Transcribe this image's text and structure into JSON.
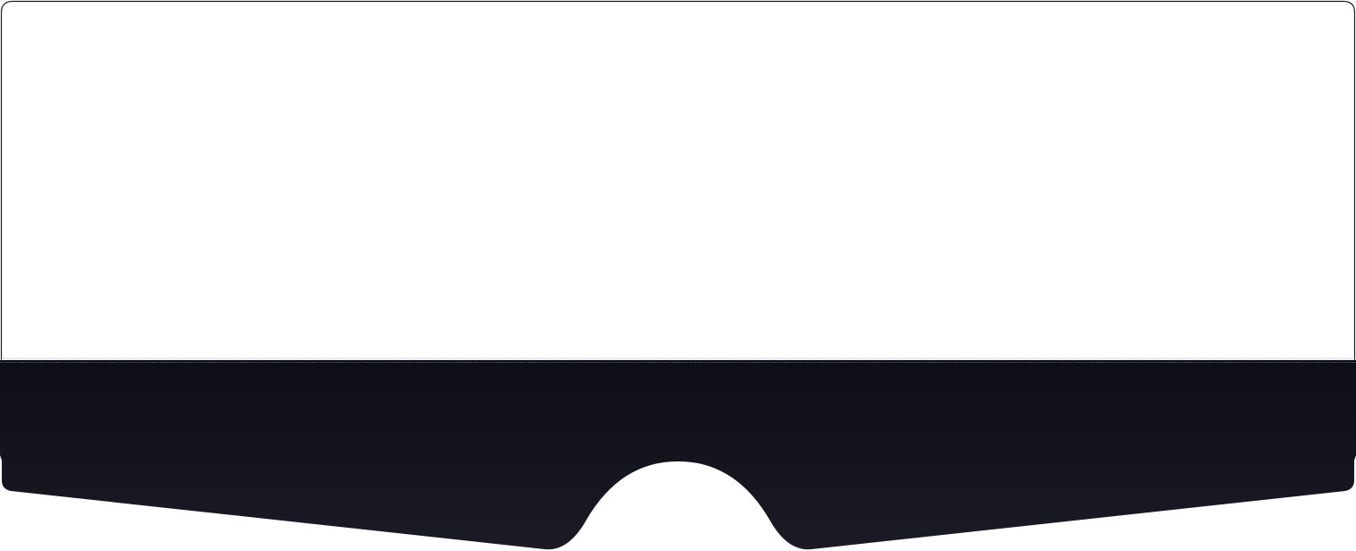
{
  "colors": {
    "page_background": "#ffffff",
    "frame_border": "#1a1b24",
    "band_top": "#0c0d17",
    "band_bottom": "#1b1b25",
    "noise_edge": "#b8b8bc"
  }
}
